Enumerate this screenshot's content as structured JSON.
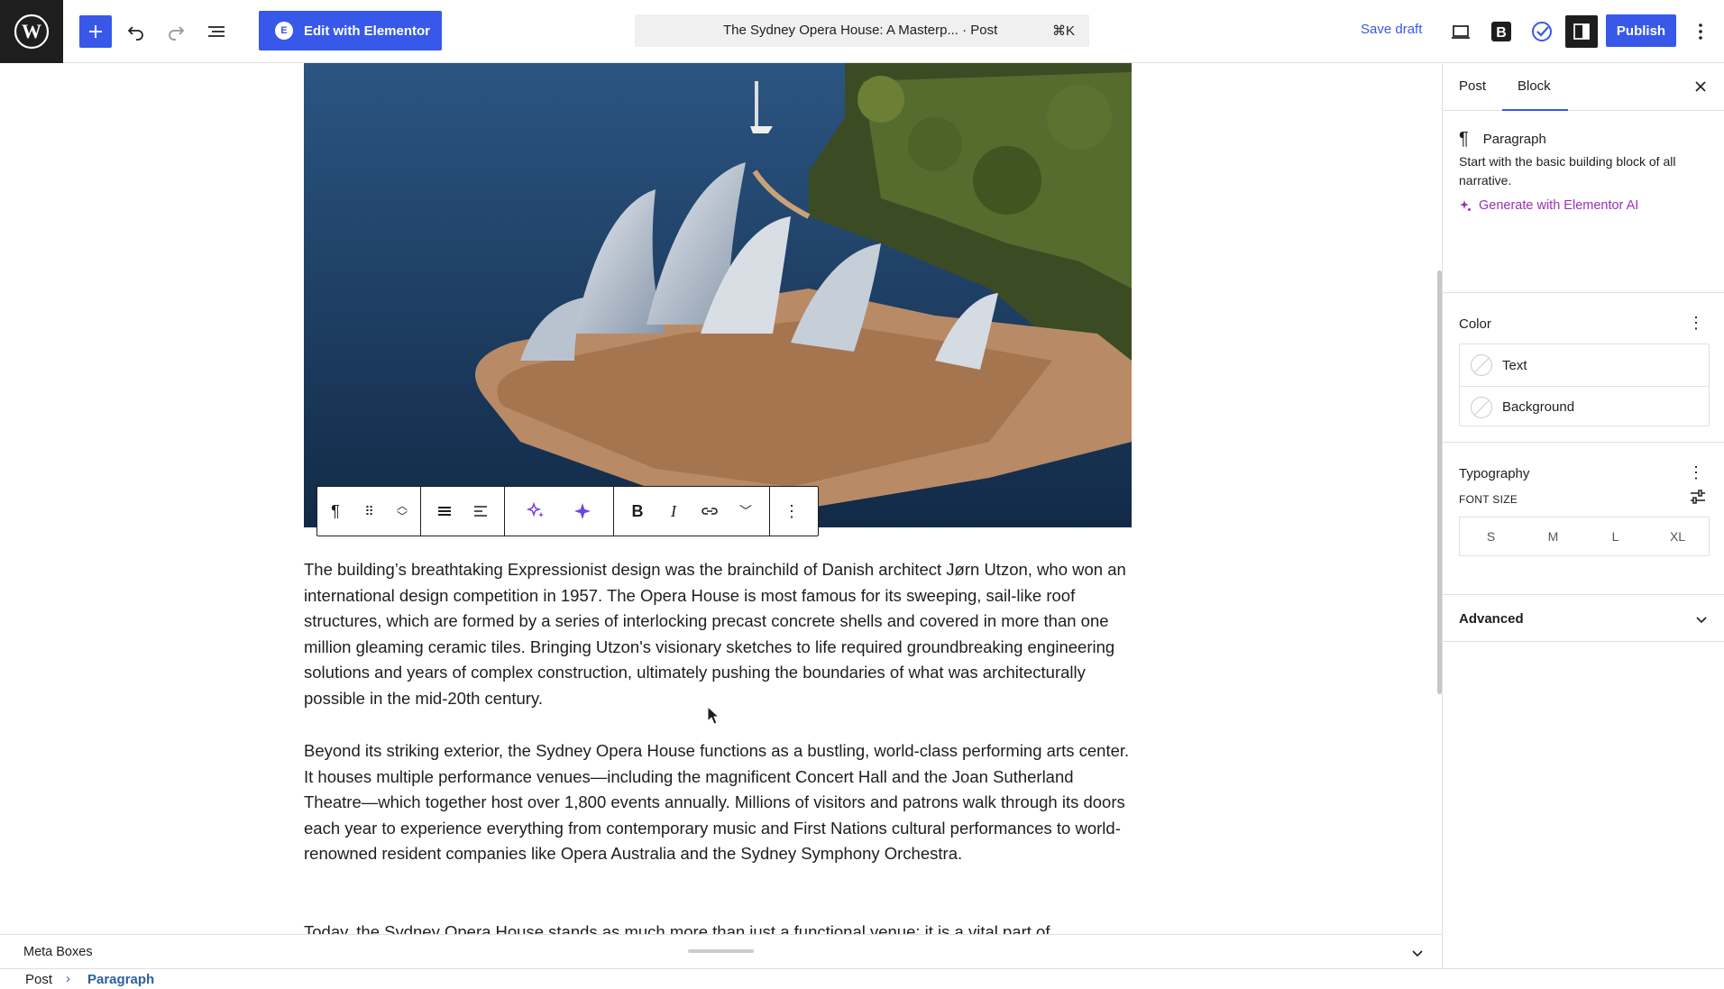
{
  "topbar": {
    "logo_icon": "wordpress-logo-icon",
    "add_icon": "plus-icon",
    "undo_icon": "undo-icon",
    "redo_icon": "redo-icon",
    "list_view_icon": "list-view-icon",
    "elementor_label": "Edit with Elementor",
    "doc_title": "The Sydney Opera House: A Masterp... · Post",
    "shortcut": "⌘K",
    "save_draft": "Save draft",
    "preview_icon": "desktop-preview-icon",
    "publish": "Publish",
    "accent": "#3858e9"
  },
  "editor": {
    "toolbar": {
      "items": [
        "paragraph-icon",
        "drag-handle-icon",
        "move-up-down-icon",
        "align-icon",
        "text-align-icon",
        "ai-sparkle-icon",
        "ai-star-icon",
        "bold-icon",
        "italic-icon",
        "link-icon",
        "more-chevron-icon",
        "options-icon"
      ]
    },
    "paragraphs": [
      "The building’s breathtaking Expressionist design was the brainchild of Danish architect Jørn Utzon, who won an international design competition in 1957. The Opera House is most famous for its sweeping, sail-like roof structures, which are formed by a series of interlocking precast concrete shells and covered in more than one million gleaming ceramic tiles. Bringing Utzon's visionary sketches to life required groundbreaking engineering solutions and years of complex construction, ultimately pushing the boundaries of what was architecturally possible in the mid-20th century.",
      "Beyond its striking exterior, the Sydney Opera House functions as a bustling, world-class performing arts center. It houses multiple performance venues—including the magnificent Concert Hall and the Joan Sutherland Theatre—which together host over 1,800 events annually. Millions of visitors and patrons walk through its doors each year to experience everything from contemporary music and First Nations cultural performances to world-renowned resident companies like Opera Australia and the Sydney Symphony Orchestra.",
      "Today, the Sydney Opera House stands as much more than just a functional venue; it is a vital part of"
    ]
  },
  "meta": {
    "label": "Meta Boxes"
  },
  "breadcrumb": {
    "post": "Post",
    "sep": "›",
    "current": "Paragraph"
  },
  "sidebar": {
    "tabs": [
      "Post",
      "Block"
    ],
    "active_tab": "Block",
    "block": {
      "name": "Paragraph",
      "description": "Start with the basic building block of all narrative.",
      "ai_link": "Generate with Elementor AI"
    },
    "color": {
      "title": "Color",
      "text": "Text",
      "background": "Background"
    },
    "typography": {
      "title": "Typography",
      "font_size_label": "FONT SIZE",
      "sizes": [
        "S",
        "M",
        "L",
        "XL"
      ]
    },
    "advanced": {
      "title": "Advanced"
    }
  }
}
